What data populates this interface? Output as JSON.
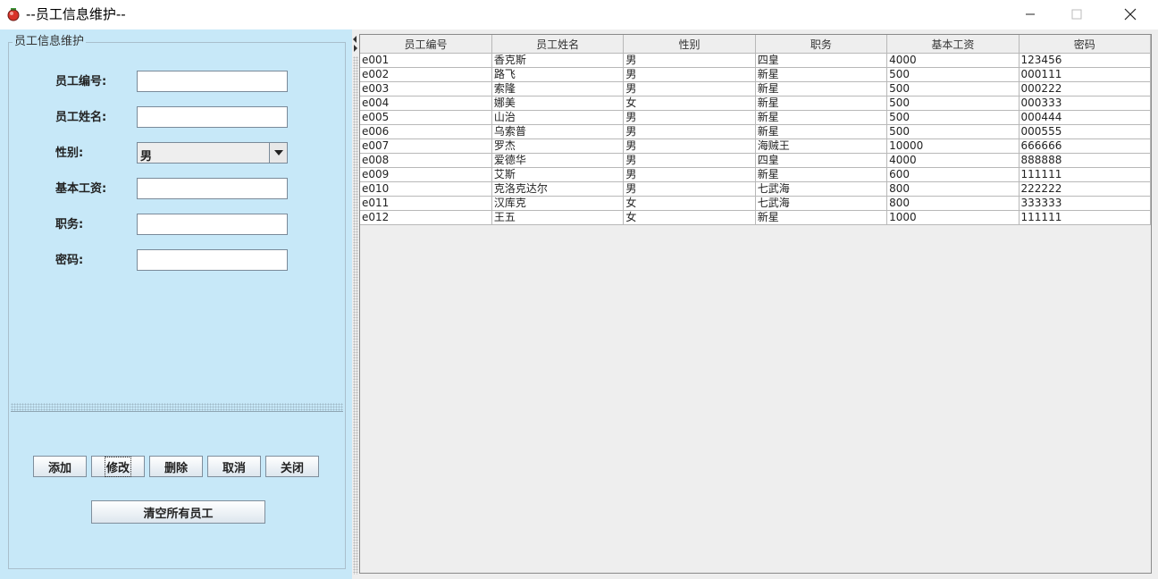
{
  "window": {
    "title": "--员工信息维护--"
  },
  "form": {
    "group_title": "员工信息维护",
    "fields": [
      {
        "label": "员工编号:",
        "value": ""
      },
      {
        "label": "员工姓名:",
        "value": ""
      },
      {
        "label": "性别:",
        "value": "男"
      },
      {
        "label": "基本工资:",
        "value": ""
      },
      {
        "label": "职务:",
        "value": ""
      },
      {
        "label": "密码:",
        "value": ""
      }
    ]
  },
  "buttons": {
    "add": "添加",
    "modify": "修改",
    "delete": "删除",
    "cancel": "取消",
    "close": "关闭",
    "clear_all": "清空所有员工"
  },
  "table": {
    "headers": [
      "员工编号",
      "员工姓名",
      "性别",
      "职务",
      "基本工资",
      "密码"
    ],
    "rows": [
      [
        "e001",
        "香克斯",
        "男",
        "四皇",
        "4000",
        "123456"
      ],
      [
        "e002",
        "路飞",
        "男",
        "新星",
        "500",
        "000111"
      ],
      [
        "e003",
        "索隆",
        "男",
        "新星",
        "500",
        "000222"
      ],
      [
        "e004",
        "娜美",
        "女",
        "新星",
        "500",
        "000333"
      ],
      [
        "e005",
        "山治",
        "男",
        "新星",
        "500",
        "000444"
      ],
      [
        "e006",
        "乌索普",
        "男",
        "新星",
        "500",
        "000555"
      ],
      [
        "e007",
        "罗杰",
        "男",
        "海贼王",
        "10000",
        "666666"
      ],
      [
        "e008",
        "爱德华",
        "男",
        "四皇",
        "4000",
        "888888"
      ],
      [
        "e009",
        "艾斯",
        "男",
        "新星",
        "600",
        "111111"
      ],
      [
        "e010",
        "克洛克达尔",
        "男",
        "七武海",
        "800",
        "222222"
      ],
      [
        "e011",
        "汉库克",
        "女",
        "七武海",
        "800",
        "333333"
      ],
      [
        "e012",
        "王五",
        "女",
        "新星",
        "1000",
        "111111"
      ]
    ]
  },
  "icons": {
    "app": "app-icon",
    "minimize": "minimize-icon",
    "maximize": "maximize-icon",
    "close": "close-icon",
    "dropdown": "chevron-down-icon"
  },
  "colors": {
    "panel_bg": "#c7e8f8",
    "client_bg": "#eeeeee"
  }
}
